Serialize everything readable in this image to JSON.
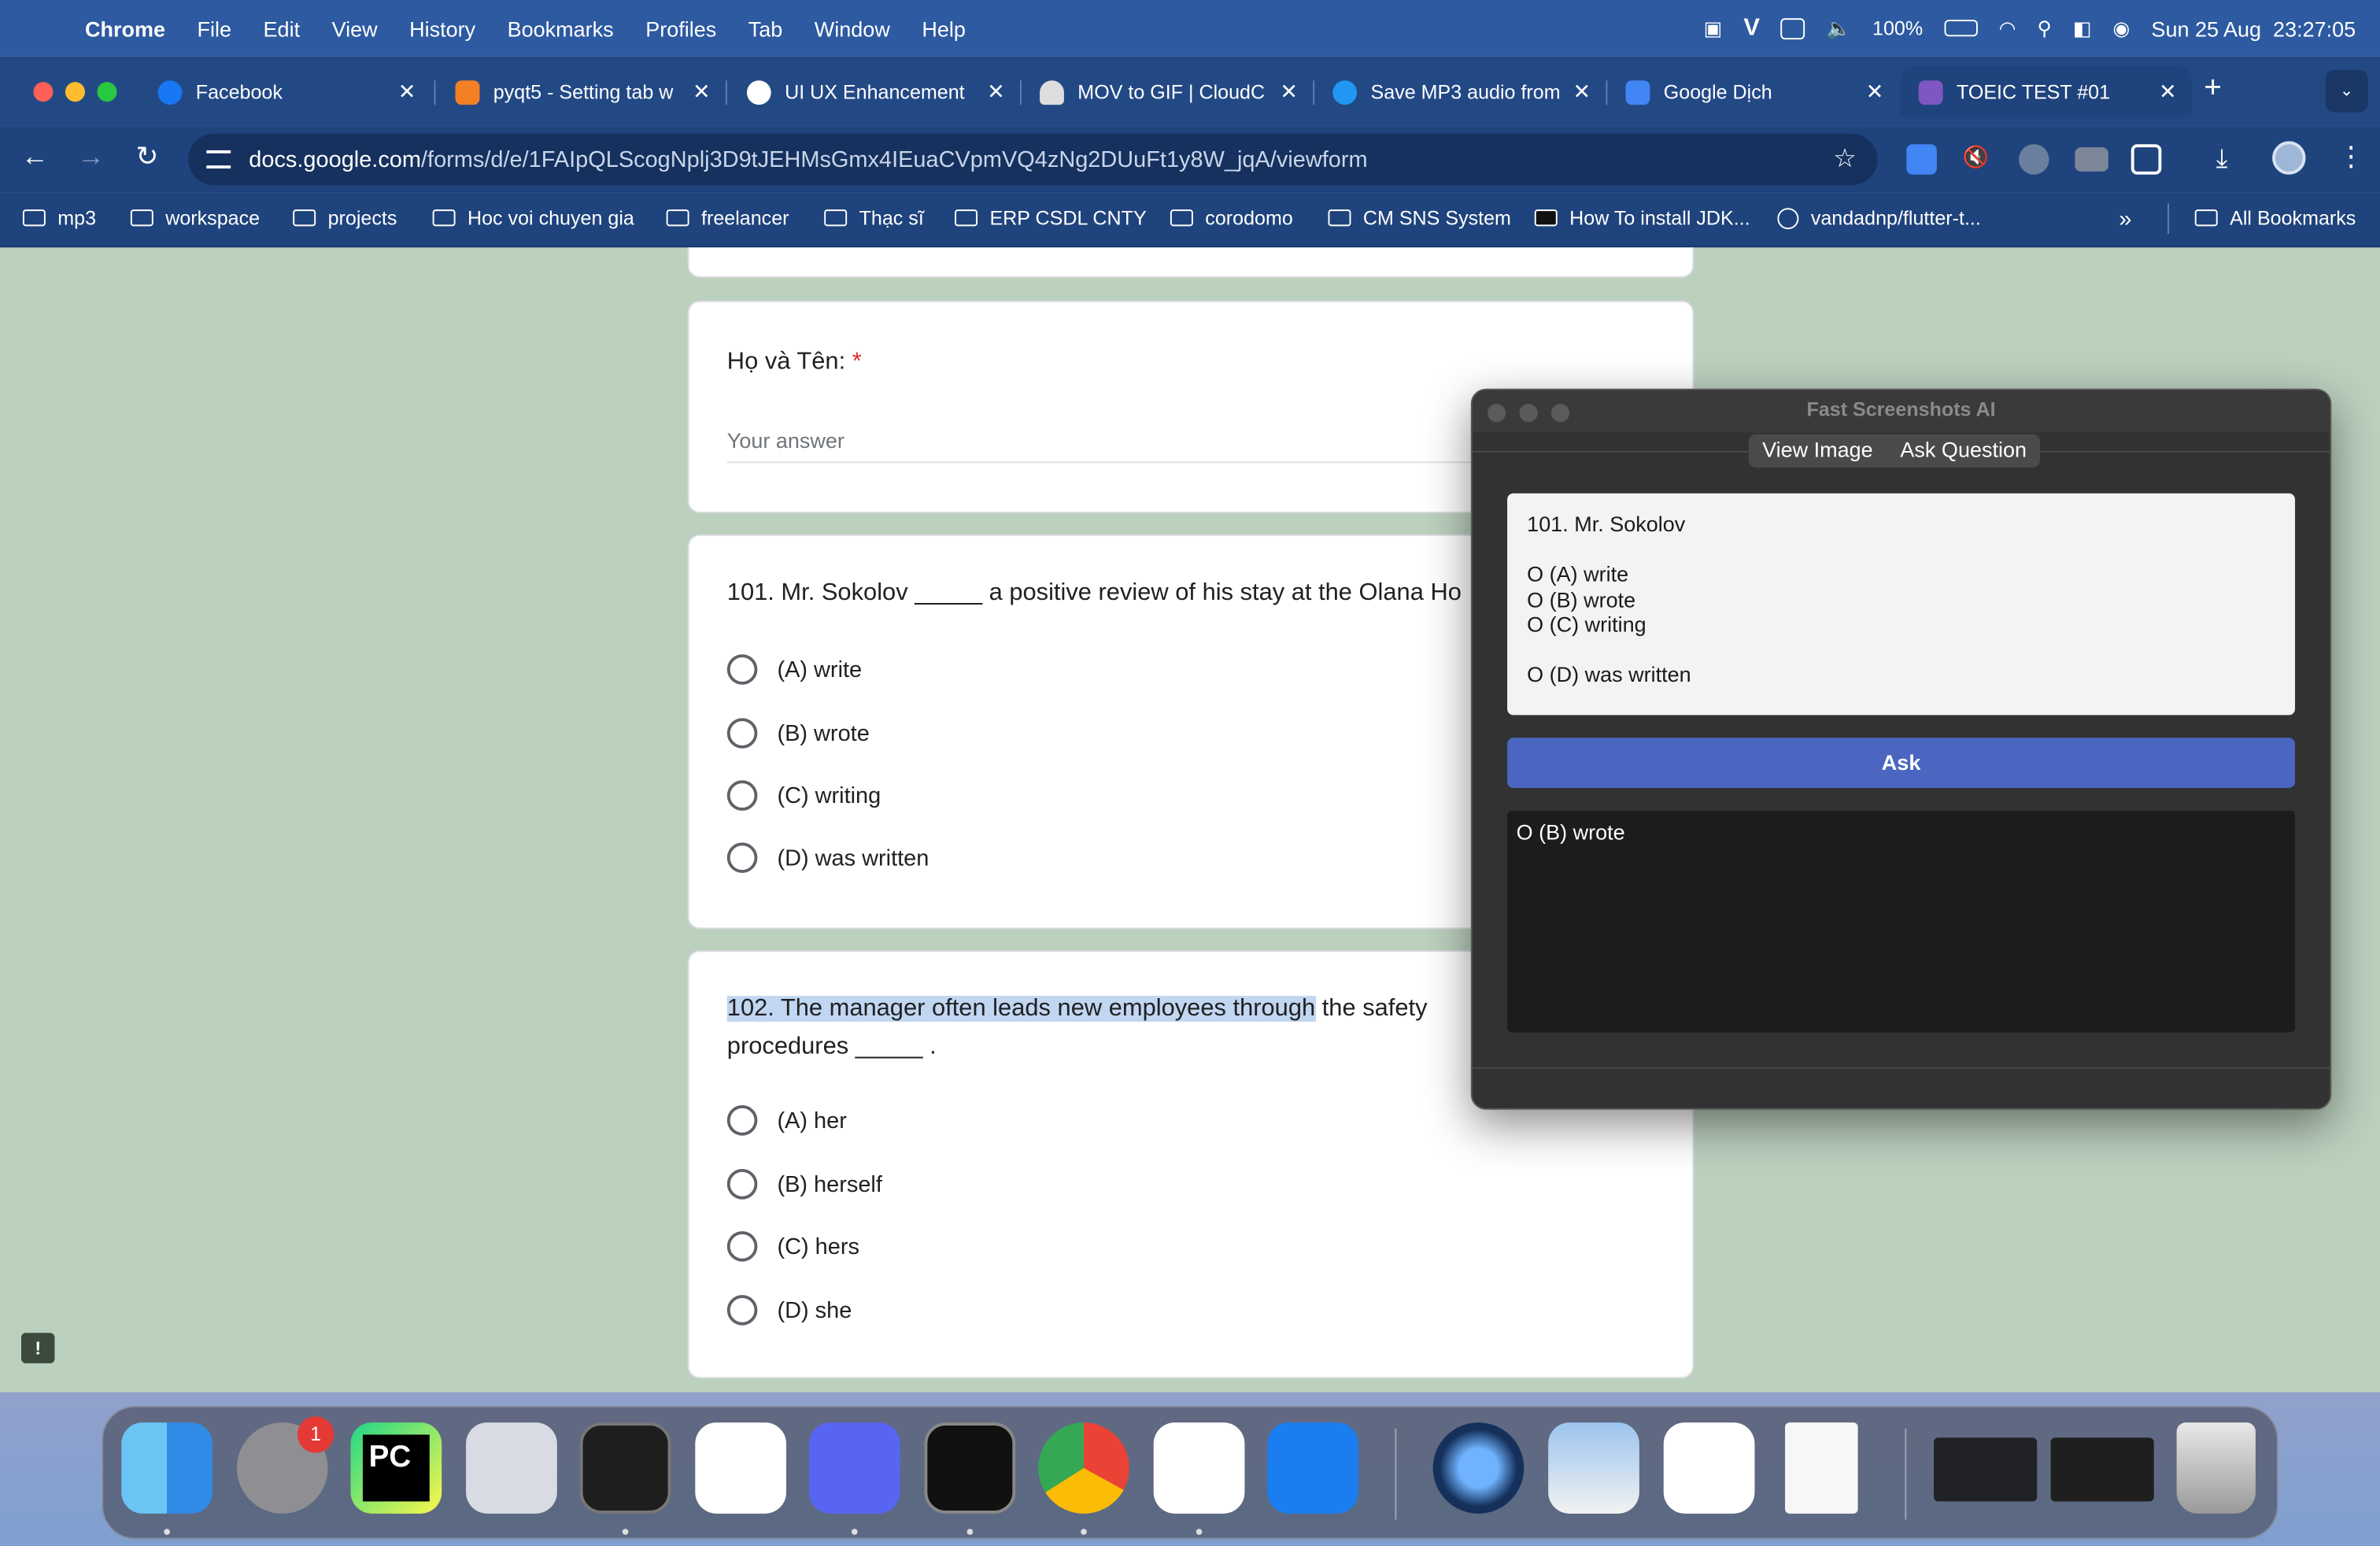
{
  "menubar": {
    "app": "Chrome",
    "items": [
      "File",
      "Edit",
      "View",
      "History",
      "Bookmarks",
      "Profiles",
      "Tab",
      "Window",
      "Help"
    ],
    "battery": "100%",
    "datetime": "Sun 25 Aug  23:27:05"
  },
  "tabs": [
    {
      "title": "Facebook",
      "color": "#1877f2"
    },
    {
      "title": "pyqt5 - Setting tab w",
      "color": "#f48024"
    },
    {
      "title": "UI UX Enhancement",
      "color": "#ffffff"
    },
    {
      "title": "MOV to GIF | CloudC",
      "color": "#e0e0e0"
    },
    {
      "title": "Save MP3 audio from",
      "color": "#2196f3"
    },
    {
      "title": "Google Dịch",
      "color": "#4285f4"
    },
    {
      "title": "TOEIC TEST #01",
      "color": "#7e57c2"
    }
  ],
  "url": {
    "host": "docs.google.com",
    "path": "/forms/d/e/1FAIpQLScogNplj3D9tJEHMsGmx4IEuaCVpmVQ4zNg2DUuFt1y8W_jqA/viewform"
  },
  "bookmarks": [
    "mp3",
    "workspace",
    "projects",
    "Hoc voi chuyen gia",
    "freelancer",
    "Thạc sĩ",
    "ERP CSDL CNTY",
    "corodomo",
    "CM SNS System",
    "How To install JDK...",
    "vandadnp/flutter-t...",
    "»",
    "All Bookmarks"
  ],
  "form": {
    "name_label": "Họ và Tên:",
    "required_mark": "*",
    "answer_placeholder": "Your answer",
    "q101": {
      "text": "101. Mr. Sokolov _____ a positive review of his stay at the Olana Ho",
      "options": [
        "(A) write",
        "(B) wrote",
        "(C) writing",
        "(D) was written"
      ]
    },
    "q102": {
      "text_highlighted": "102. The manager often leads new employees through",
      "text_rest": " the safety",
      "text_line2": "procedures _____ .",
      "options": [
        "(A) her",
        "(B) herself",
        "(C) hers",
        "(D) she"
      ]
    }
  },
  "fsai": {
    "title": "Fast Screenshots AI",
    "tab_view": "View Image",
    "tab_ask": "Ask Question",
    "question_text": "101. Mr. Sokolov\n\nO (A) write\nO (B) wrote\nO (C) writing\n\nO (D) was written",
    "ask_label": "Ask",
    "answer": "O (B) wrote"
  },
  "dock": {
    "settings_badge": "1",
    "apps": [
      "finder-icon",
      "system-settings-icon",
      "pycharm-icon",
      "launchpad-icon",
      "activity-monitor-icon",
      "slack-icon",
      "discord-icon",
      "terminal-icon",
      "chrome-icon",
      "vscode-icon",
      "xcode-icon",
      "quicktime-icon",
      "preview-icon",
      "capcut-icon",
      "document-icon",
      "window-thumb-1",
      "window-thumb-2",
      "trash-icon"
    ]
  }
}
